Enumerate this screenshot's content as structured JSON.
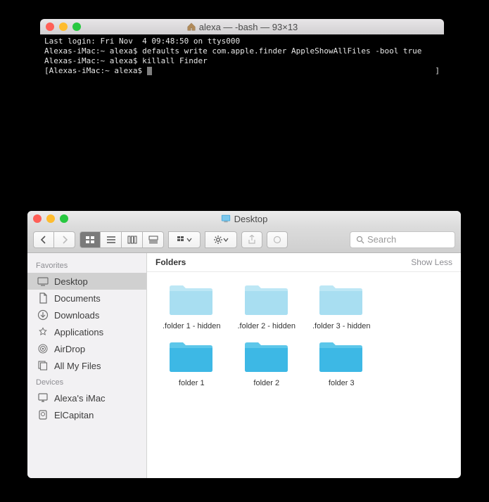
{
  "terminal": {
    "title": "alexa — -bash — 93×13",
    "lines": [
      "Last login: Fri Nov  4 09:48:50 on ttys000",
      "Alexas-iMac:~ alexa$ defaults write com.apple.finder AppleShowAllFiles -bool true",
      "Alexas-iMac:~ alexa$ killall Finder",
      "[Alexas-iMac:~ alexa$ "
    ]
  },
  "finder": {
    "title": "Desktop",
    "search_placeholder": "Search",
    "sidebar": {
      "sections": [
        {
          "header": "Favorites",
          "items": [
            {
              "label": "Desktop",
              "icon": "desktop",
              "selected": true
            },
            {
              "label": "Documents",
              "icon": "doc",
              "selected": false
            },
            {
              "label": "Downloads",
              "icon": "download",
              "selected": false
            },
            {
              "label": "Applications",
              "icon": "app",
              "selected": false
            },
            {
              "label": "AirDrop",
              "icon": "airdrop",
              "selected": false
            },
            {
              "label": "All My Files",
              "icon": "allfiles",
              "selected": false
            }
          ]
        },
        {
          "header": "Devices",
          "items": [
            {
              "label": "Alexa's iMac",
              "icon": "imac",
              "selected": false
            },
            {
              "label": "ElCapitan",
              "icon": "disk",
              "selected": false
            }
          ]
        }
      ]
    },
    "group_label": "Folders",
    "show_less_label": "Show Less",
    "folders": [
      {
        "name": ".folder 1 - hidden",
        "hidden": true
      },
      {
        "name": ".folder 2 - hidden",
        "hidden": true
      },
      {
        "name": ".folder 3 - hidden",
        "hidden": true
      },
      {
        "name": "folder 1",
        "hidden": false
      },
      {
        "name": "folder 2",
        "hidden": false
      },
      {
        "name": "folder 3",
        "hidden": false
      }
    ]
  }
}
